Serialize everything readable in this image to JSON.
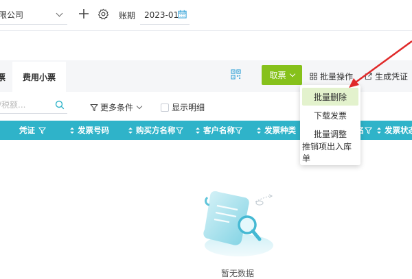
{
  "header": {
    "company": "限公司",
    "period_label": "账期",
    "period_value": "2023-01"
  },
  "tabs": [
    {
      "label": "票"
    },
    {
      "label": "费用小票"
    }
  ],
  "toolbar": {
    "take_ticket": "取票",
    "bulk_ops": "批量操作",
    "gen_voucher": "生成凭证"
  },
  "filters": {
    "search_placeholder": "/税额...",
    "more_conditions": "更多条件",
    "show_detail": "显示明细"
  },
  "table": {
    "columns": [
      "凭证",
      "发票号码",
      "购买方名称",
      "客户名称",
      "发票种类",
      "名",
      "发票状态"
    ]
  },
  "dropdown": {
    "items": [
      "批量删除",
      "下载发票",
      "批量调整",
      "推销项出入库单"
    ]
  },
  "empty": {
    "text": "暂无数据"
  },
  "colors": {
    "accent_green": "#86c11b",
    "header_teal": "#2fb3c9",
    "arrow_red": "#e02a2a"
  }
}
